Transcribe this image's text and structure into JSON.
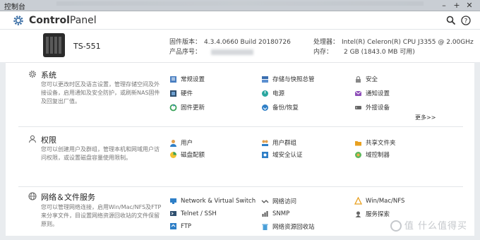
{
  "window": {
    "title": "控制台",
    "controls": [
      "minimize-icon",
      "maximize-icon",
      "close-icon"
    ]
  },
  "header": {
    "brand_bold": "Control",
    "brand_rest": "Panel",
    "icons": [
      "search-icon",
      "help-icon"
    ]
  },
  "device": {
    "model": "TS-551",
    "firmware_label": "固件版本：",
    "firmware_value": "4.3.4.0660 Build 20180726",
    "serial_label": "产品序号：",
    "cpu_label": "处理器：",
    "cpu_value": "Intel(R) Celeron(R) CPU J3355 @ 2.00GHz",
    "memory_label": "内存：",
    "memory_value": "2 GB (1843.0 MB 可用)"
  },
  "sections": [
    {
      "title": "系统",
      "desc": "您可以更改时区及语言设置，管理存储空间及外接设备，启用通知及安全防护，或刷新NAS固件及回复出厂值。",
      "items": [
        [
          "常规设置",
          "存储与快照总管",
          "安全"
        ],
        [
          "硬件",
          "电源",
          "通知设置"
        ],
        [
          "固件更新",
          "备份/恢复",
          "外接设备"
        ]
      ],
      "more": "更多>>"
    },
    {
      "title": "权限",
      "desc": "您可以创建用户及群组，管理本机和网域用户访问权限，或设置磁盘容量使用限制。",
      "items": [
        [
          "用户",
          "用户群组",
          "共享文件夹"
        ],
        [
          "磁盘配额",
          "域安全认证",
          "域控制器"
        ]
      ]
    },
    {
      "title": "网络＆文件服务",
      "desc": "您可以管理网络连接，启用Win/Mac/NFS及FTP来分享文件，目设置网络资源回收站的文件保留原则。",
      "items": [
        [
          "Network & Virtual Switch",
          "网络访问",
          "Win/Mac/NFS"
        ],
        [
          "Telnet / SSH",
          "SNMP",
          "服务探索"
        ],
        [
          "FTP",
          "网络资源回收站",
          ""
        ]
      ]
    }
  ],
  "watermark": "值 什么值得买",
  "colors": {
    "accent": "#2e7fc7",
    "window_bar": "#c9ced4",
    "background": "#e9ecef"
  }
}
